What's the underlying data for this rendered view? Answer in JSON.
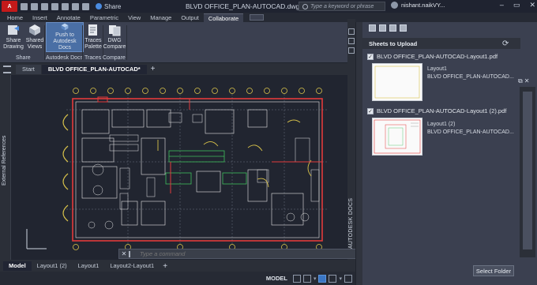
{
  "titlebar": {
    "app_logo": "A",
    "share_label": "Share",
    "doc_title": "BLVD OFFICE_PLAN-AUTOCAD.dwg",
    "search_placeholder": "Type a keyword or phrase",
    "user_name": "nishant.naikVY...",
    "icons": [
      "new-icon",
      "open-icon",
      "save-icon",
      "saveas-icon",
      "print-icon",
      "undo-icon",
      "redo-icon"
    ]
  },
  "ribbon_tabs": [
    "Home",
    "Insert",
    "Annotate",
    "Parametric",
    "View",
    "Manage",
    "Output",
    "Collaborate"
  ],
  "active_ribbon_tab": "Collaborate",
  "ribbon": {
    "share_drawing": "Share Drawing",
    "shared_views": "Shared Views",
    "share_panel": "Share",
    "push_autodesk": "Push to Autodesk Docs",
    "autodesk_panel": "Autodesk Docs",
    "traces_palette": "Traces Palette",
    "traces_panel": "Traces",
    "dwg_compare": "DWG Compare",
    "compare_panel": "Compare"
  },
  "doc_tabs": {
    "start": "Start",
    "active": "BLVD OFFICE_PLAN-AUTOCAD*",
    "plus": "+"
  },
  "drawing": {
    "xref_label": "External References",
    "push_docs_label": "PUSH TO AUTODESK DOCS"
  },
  "cmdline": {
    "close": "✕",
    "placeholder": "Type a command"
  },
  "layout_tabs": [
    "Model",
    "Layout1 (2)",
    "Layout1",
    "Layout2-Layout1"
  ],
  "layout_plus": "+",
  "statusbar": {
    "model": "MODEL"
  },
  "palette": {
    "header": "Sheets to Upload",
    "files": [
      {
        "name": "BLVD OFFICE_PLAN-AUTOCAD-Layout1.pdf",
        "layout": "Layout1",
        "source": "BLVD OFFICE_PLAN-AUTOCAD..."
      },
      {
        "name": "BLVD OFFICE_PLAN-AUTOCAD-Layout1 (2).pdf",
        "layout": "Layout1 (2)",
        "source": "BLVD OFFICE_PLAN-AUTOCAD..."
      }
    ],
    "select_folder": "Select Folder"
  },
  "colors": {
    "accent": "#4a8be0",
    "cad_red": "#e23b3b",
    "cad_yellow": "#d8c24a",
    "cad_green": "#3fbf5c",
    "cad_white": "#e6e6e6"
  }
}
